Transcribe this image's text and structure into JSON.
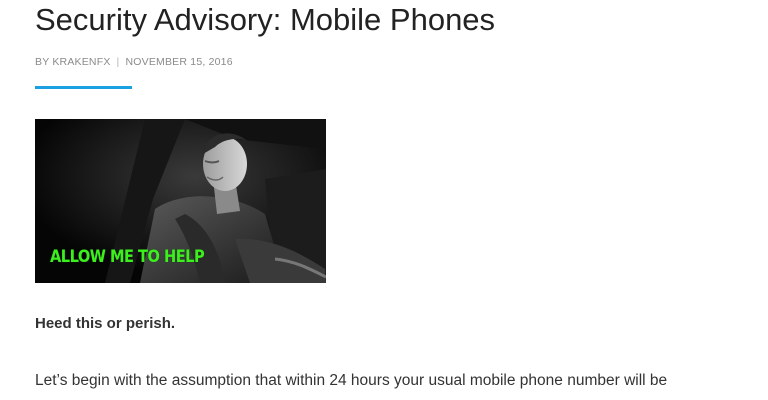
{
  "article": {
    "title": "Security Advisory: Mobile Phones",
    "meta": {
      "author": "BY KRAKENFX",
      "separator": "|",
      "date": "NOVEMBER 15, 2016"
    },
    "accent_color": "#1ba0e1",
    "featured_image": {
      "caption": "ALLOW ME TO HELP",
      "caption_color": "#3cf01e"
    },
    "lead": "Heed this or perish.",
    "paragraphs": [
      "Let’s begin with the assumption that within 24 hours your usual mobile phone number will be"
    ]
  }
}
